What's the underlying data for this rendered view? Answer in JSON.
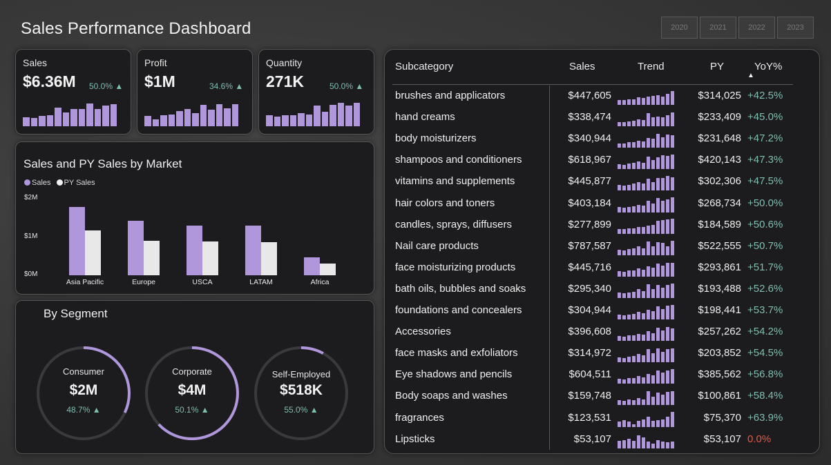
{
  "header": {
    "title": "Sales Performance Dashboard",
    "years": [
      "2020",
      "2021",
      "2022",
      "2023"
    ]
  },
  "colors": {
    "accent": "#b097dc",
    "py": "#e8e8e8",
    "positive": "#7fbfb0",
    "negative": "#e05a48"
  },
  "kpis": [
    {
      "label": "Sales",
      "value": "$6.36M",
      "change": "50.0% ▲",
      "bars": [
        0.38,
        0.36,
        0.44,
        0.46,
        0.78,
        0.6,
        0.73,
        0.74,
        0.97,
        0.73,
        0.89,
        0.93
      ]
    },
    {
      "label": "Profit",
      "value": "$1M",
      "change": "34.6% ▲",
      "bars": [
        0.44,
        0.29,
        0.47,
        0.49,
        0.64,
        0.73,
        0.56,
        0.92,
        0.71,
        0.93,
        0.76,
        0.93
      ]
    },
    {
      "label": "Quantity",
      "value": "271K",
      "change": "50.0% ▲",
      "bars": [
        0.46,
        0.41,
        0.46,
        0.48,
        0.56,
        0.51,
        0.89,
        0.63,
        0.92,
        0.99,
        0.88,
        1.0
      ]
    }
  ],
  "market_chart": {
    "title": "Sales and PY Sales by Market",
    "legend": [
      "Sales",
      "PY Sales"
    ],
    "y_ticks": [
      "$2M",
      "$1M",
      "$0M"
    ]
  },
  "segment": {
    "title": "By Segment",
    "items": [
      {
        "label": "Consumer",
        "value": "$2M",
        "change": "48.7% ▲",
        "fraction": 0.32
      },
      {
        "label": "Corporate",
        "value": "$4M",
        "change": "50.1% ▲",
        "fraction": 0.63
      },
      {
        "label": "Self-Employed",
        "value": "$518K",
        "change": "55.0% ▲",
        "fraction": 0.08
      }
    ]
  },
  "table": {
    "headers": {
      "subcategory": "Subcategory",
      "sales": "Sales",
      "trend": "Trend",
      "py": "PY",
      "yoy": "YoY%"
    },
    "sort_indicator": "▲",
    "rows": [
      {
        "name": "brushes and applicators",
        "sales": "$447,605",
        "py": "$314,025",
        "yoy": "+42.5%",
        "trend": [
          0.34,
          0.3,
          0.36,
          0.38,
          0.52,
          0.46,
          0.56,
          0.58,
          0.62,
          0.54,
          0.72,
          0.92
        ]
      },
      {
        "name": "hand creams",
        "sales": "$338,474",
        "py": "$233,409",
        "yoy": "+45.0%",
        "trend": [
          0.3,
          0.28,
          0.34,
          0.36,
          0.48,
          0.42,
          0.88,
          0.58,
          0.66,
          0.58,
          0.72,
          0.9
        ]
      },
      {
        "name": "body moisturizers",
        "sales": "$340,944",
        "py": "$231,648",
        "yoy": "+47.2%",
        "trend": [
          0.3,
          0.28,
          0.36,
          0.36,
          0.46,
          0.4,
          0.64,
          0.58,
          0.92,
          0.7,
          0.88,
          0.84
        ]
      },
      {
        "name": "shampoos and conditioners",
        "sales": "$618,967",
        "py": "$420,143",
        "yoy": "+47.3%",
        "trend": [
          0.34,
          0.3,
          0.4,
          0.42,
          0.52,
          0.44,
          0.82,
          0.62,
          0.8,
          0.94,
          0.86,
          0.96
        ]
      },
      {
        "name": "vitamins and supplements",
        "sales": "$445,877",
        "py": "$302,306",
        "yoy": "+47.5%",
        "trend": [
          0.36,
          0.32,
          0.4,
          0.46,
          0.58,
          0.48,
          0.78,
          0.58,
          0.84,
          0.82,
          0.96,
          0.9
        ]
      },
      {
        "name": "hair colors and toners",
        "sales": "$403,184",
        "py": "$268,734",
        "yoy": "+50.0%",
        "trend": [
          0.34,
          0.3,
          0.36,
          0.4,
          0.46,
          0.42,
          0.76,
          0.56,
          0.92,
          0.74,
          0.86,
          0.96
        ]
      },
      {
        "name": "candles, sprays, diffusers",
        "sales": "$277,899",
        "py": "$184,589",
        "yoy": "+50.6%",
        "trend": [
          0.32,
          0.3,
          0.34,
          0.36,
          0.44,
          0.42,
          0.52,
          0.56,
          0.84,
          0.88,
          0.92,
          0.96
        ]
      },
      {
        "name": "Nail care products",
        "sales": "$787,587",
        "py": "$522,555",
        "yoy": "+50.7%",
        "trend": [
          0.34,
          0.3,
          0.38,
          0.42,
          0.56,
          0.46,
          0.88,
          0.58,
          0.86,
          0.8,
          0.58,
          0.92
        ]
      },
      {
        "name": "face moisturizing products",
        "sales": "$445,716",
        "py": "$293,861",
        "yoy": "+51.7%",
        "trend": [
          0.34,
          0.3,
          0.38,
          0.4,
          0.52,
          0.44,
          0.68,
          0.6,
          0.86,
          0.7,
          0.88,
          0.92
        ]
      },
      {
        "name": "bath oils, bubbles and soaks",
        "sales": "$295,340",
        "py": "$193,488",
        "yoy": "+52.6%",
        "trend": [
          0.36,
          0.3,
          0.38,
          0.4,
          0.58,
          0.46,
          0.92,
          0.6,
          0.88,
          0.7,
          0.84,
          0.94
        ]
      },
      {
        "name": "foundations and concealers",
        "sales": "$304,944",
        "py": "$198,441",
        "yoy": "+53.7%",
        "trend": [
          0.3,
          0.26,
          0.34,
          0.36,
          0.5,
          0.42,
          0.62,
          0.56,
          0.86,
          0.7,
          0.9,
          0.96
        ]
      },
      {
        "name": "Accessories",
        "sales": "$396,608",
        "py": "$257,262",
        "yoy": "+54.2%",
        "trend": [
          0.32,
          0.3,
          0.36,
          0.36,
          0.46,
          0.4,
          0.62,
          0.52,
          0.86,
          0.7,
          0.9,
          0.84
        ]
      },
      {
        "name": "face masks and exfoliators",
        "sales": "$314,972",
        "py": "$203,852",
        "yoy": "+54.5%",
        "trend": [
          0.32,
          0.3,
          0.36,
          0.42,
          0.56,
          0.48,
          0.88,
          0.6,
          0.9,
          0.7,
          0.88,
          0.92
        ]
      },
      {
        "name": "Eye shadows and pencils",
        "sales": "$604,511",
        "py": "$385,562",
        "yoy": "+56.8%",
        "trend": [
          0.34,
          0.3,
          0.38,
          0.4,
          0.52,
          0.44,
          0.66,
          0.56,
          0.88,
          0.72,
          0.86,
          0.96
        ]
      },
      {
        "name": "Body soaps and washes",
        "sales": "$159,748",
        "py": "$100,861",
        "yoy": "+58.4%",
        "trend": [
          0.32,
          0.28,
          0.36,
          0.32,
          0.46,
          0.4,
          0.92,
          0.58,
          0.84,
          0.7,
          0.88,
          0.94
        ]
      },
      {
        "name": "fragrances",
        "sales": "$123,531",
        "py": "$75,370",
        "yoy": "+63.9%",
        "trend": [
          0.36,
          0.42,
          0.32,
          0.14,
          0.4,
          0.46,
          0.66,
          0.4,
          0.44,
          0.48,
          0.68,
          0.96
        ]
      },
      {
        "name": "Lipsticks",
        "sales": "$53,107",
        "py": "$53,107",
        "yoy": "0.0%",
        "trend": [
          0.5,
          0.52,
          0.62,
          0.46,
          0.84,
          0.72,
          0.44,
          0.3,
          0.54,
          0.42,
          0.4,
          0.44
        ]
      }
    ]
  },
  "chart_data": [
    {
      "type": "bar",
      "title": "Sales and PY Sales by Market",
      "categories": [
        "Asia Pacific",
        "Europe",
        "USCA",
        "LATAM",
        "Africa"
      ],
      "series": [
        {
          "name": "Sales",
          "values": [
            1.78,
            1.42,
            1.3,
            1.3,
            0.46
          ]
        },
        {
          "name": "PY Sales",
          "values": [
            1.18,
            0.9,
            0.88,
            0.87,
            0.31
          ]
        }
      ],
      "ylim": [
        0,
        2
      ],
      "y_ticks": [
        "$2M",
        "$1M",
        "$0M"
      ],
      "legend_position": "top-left"
    }
  ]
}
